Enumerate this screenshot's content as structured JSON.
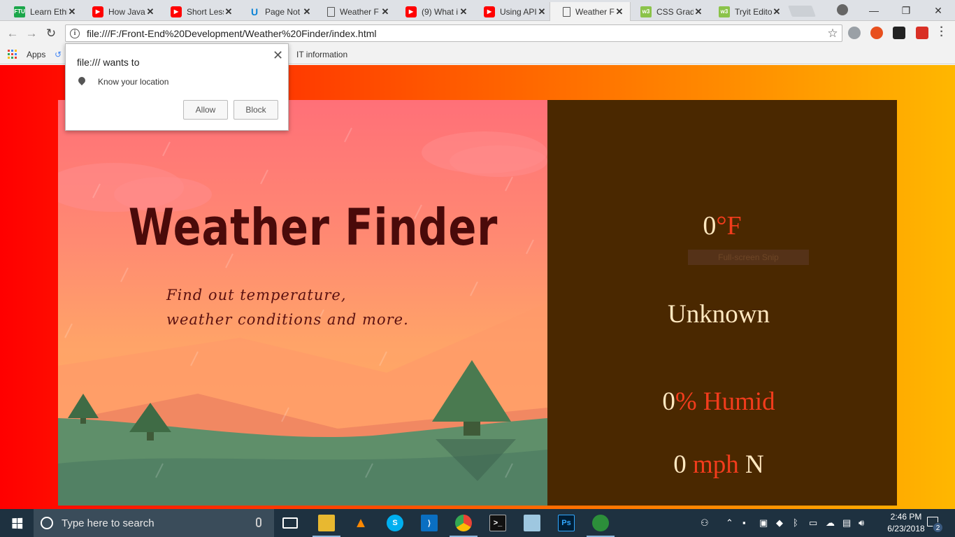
{
  "browser": {
    "tabs": [
      {
        "title": "Learn Ethi",
        "favicon": "ftu-icon",
        "favicon_text": "FTU"
      },
      {
        "title": "How Java",
        "favicon": "youtube-icon"
      },
      {
        "title": "Short Less",
        "favicon": "youtube-icon"
      },
      {
        "title": "Page Not",
        "favicon": "udemy-icon",
        "favicon_text": "U"
      },
      {
        "title": "Weather F",
        "favicon": "document-icon"
      },
      {
        "title": "(9) What i",
        "favicon": "youtube-icon"
      },
      {
        "title": "Using API",
        "favicon": "youtube-icon"
      },
      {
        "title": "Weather F",
        "favicon": "document-icon",
        "active": true
      },
      {
        "title": "CSS Gradi",
        "favicon": "w3schools-icon",
        "favicon_text": "w3"
      },
      {
        "title": "Tryit Edito",
        "favicon": "w3schools-icon",
        "favicon_text": "w3"
      }
    ],
    "address": "file:///F:/Front-End%20Development/Weather%20Finder/index.html",
    "bookmarks": {
      "apps_label": "Apps",
      "item_label": "IT information"
    },
    "window_controls": {
      "minimize": "—",
      "restore": "❐",
      "close": "✕"
    }
  },
  "permission_popup": {
    "title": "file:/// wants to",
    "request": "Know your location",
    "allow": "Allow",
    "block": "Block",
    "close": "✕"
  },
  "app": {
    "title": "Weather Finder",
    "subtitle_line1": "Find out temperature,",
    "subtitle_line2": "weather conditions and more.",
    "temperature_value": "0",
    "temperature_unit": "°F",
    "condition": "Unknown",
    "humidity_value": "0",
    "humidity_unit": "% Humid",
    "wind_speed": "0",
    "wind_unit": "mph",
    "wind_direction": "N",
    "snip_overlay": "Full-screen Snip"
  },
  "taskbar": {
    "search_placeholder": "Type here to search",
    "time": "2:46 PM",
    "date": "6/23/2018",
    "notification_count": "2"
  },
  "colors": {
    "accent": "#f23c1c",
    "panel": "#4a2800",
    "title": "#4a0a0a"
  }
}
